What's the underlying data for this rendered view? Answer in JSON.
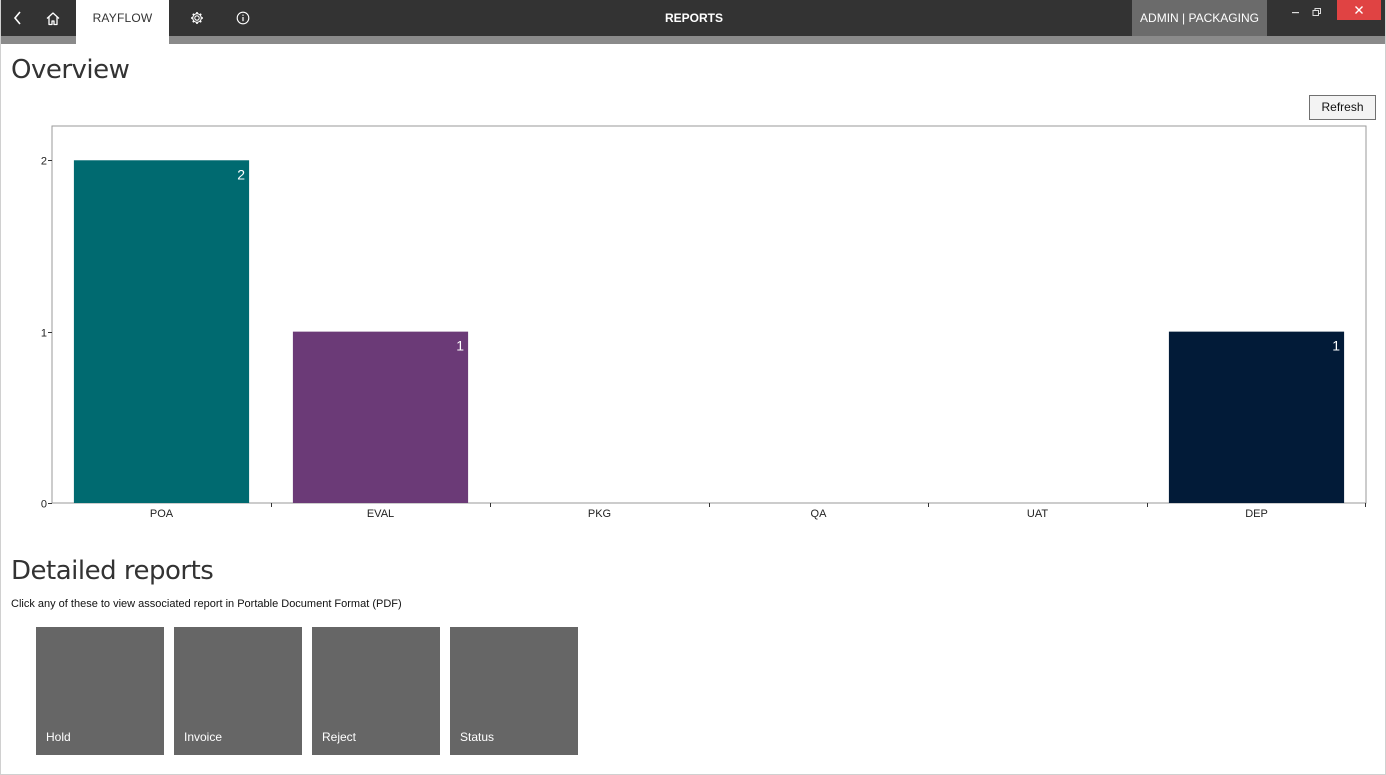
{
  "titlebar": {
    "app_tab": "RAYFLOW",
    "title": "REPORTS",
    "user": "ADMIN | PACKAGING"
  },
  "overview": {
    "heading": "Overview",
    "refresh_label": "Refresh"
  },
  "chart_data": {
    "type": "bar",
    "categories": [
      "POA",
      "EVAL",
      "PKG",
      "QA",
      "UAT",
      "DEP"
    ],
    "values": [
      2,
      1,
      0,
      0,
      0,
      1
    ],
    "colors": [
      "#006a70",
      "#6b3a77",
      null,
      null,
      null,
      "#021b38"
    ],
    "data_labels": [
      "2",
      "1",
      "",
      "",
      "",
      "1"
    ],
    "yticks": [
      "0",
      "1",
      "2"
    ],
    "ylim": [
      0,
      2.2
    ],
    "grid": false,
    "legend": "none"
  },
  "detailed": {
    "heading": "Detailed reports",
    "description": "Click any of these to view associated report in Portable Document Format (PDF)",
    "tiles": [
      {
        "label": "Hold"
      },
      {
        "label": "Invoice"
      },
      {
        "label": "Reject"
      },
      {
        "label": "Status"
      }
    ]
  },
  "icons": {
    "back": "chevron-left-icon",
    "home": "home-icon",
    "settings": "gear-icon",
    "info": "info-icon",
    "minimize": "minimize-icon",
    "restore": "restore-icon",
    "close": "close-icon"
  },
  "colors": {
    "titlebar": "#333333",
    "user_badge": "#6b6b6b",
    "close": "#e04343",
    "tile": "#666666"
  }
}
